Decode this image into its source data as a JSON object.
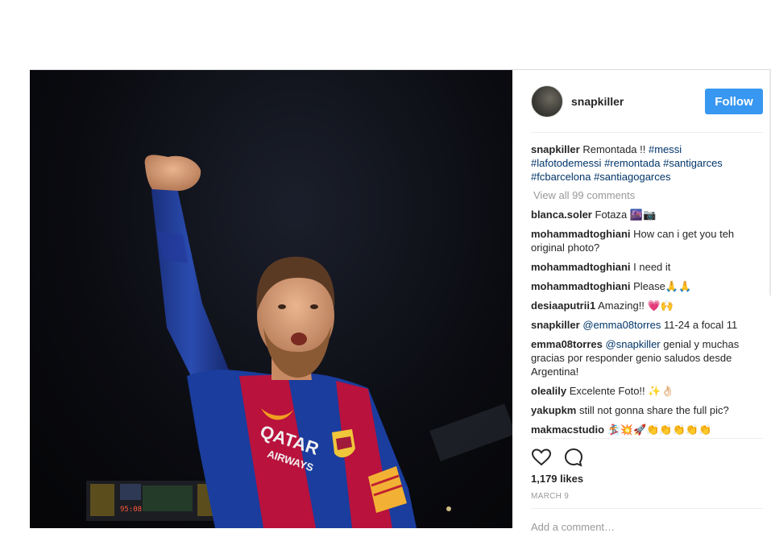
{
  "post": {
    "username": "snapkiller",
    "follow_label": "Follow",
    "caption_text": "Remontada !! ",
    "hashtags": [
      "#messi",
      "#lafotodemessi",
      "#remontada",
      "#santigarces",
      "#fcbarcelona",
      "#santiagogarces"
    ],
    "view_all": "View all 99 comments",
    "likes": "1,179 likes",
    "date": "MARCH 9",
    "add_comment": "Add a comment…"
  },
  "photo": {
    "jersey_sponsor": "QATAR AIRWAYS",
    "jersey_sponsor_line1": "QATAR",
    "jersey_sponsor_line2": "AIRWAYS"
  },
  "comments": [
    {
      "user": "blanca.soler",
      "text": "Fotaza 🌆📷"
    },
    {
      "user": "mohammadtoghiani",
      "text": "How can i get you teh original photo?"
    },
    {
      "user": "mohammadtoghiani",
      "text": "I need it"
    },
    {
      "user": "mohammadtoghiani",
      "text": "Please🙏🙏"
    },
    {
      "user": "desiaaputrii1",
      "text": "Amazing!! 💗🙌"
    },
    {
      "user": "snapkiller",
      "mention": "@emma08torres",
      "text": " 11-24 a focal 11"
    },
    {
      "user": "emma08torres",
      "mention": "@snapkiller",
      "text": " genial y muchas gracias por responder genio saludos desde Argentina!"
    },
    {
      "user": "olealily",
      "text": "Excelente Foto!! ✨👌🏻"
    },
    {
      "user": "yakupkm",
      "text": "still not gonna share the full pic?"
    },
    {
      "user": "makmacstudio",
      "text": "🏂💥🚀👏👏👏👏👏"
    }
  ],
  "icons": {
    "like": "heart-icon",
    "comment": "comment-icon"
  },
  "colors": {
    "follow_bg": "#3897f0",
    "link": "#003569",
    "muted": "#999999",
    "jersey_blue": "#1a3d9e",
    "jersey_red": "#b8123d"
  }
}
